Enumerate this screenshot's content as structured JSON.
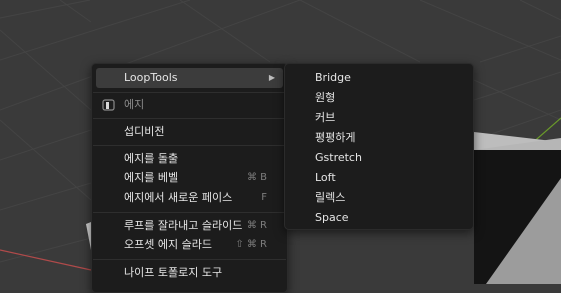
{
  "edge_menu": {
    "submenu_label": "LoopTools",
    "section_title": "에지",
    "items": {
      "subdivide": "섭디비전",
      "extrude_edges": "에지를 돌출",
      "bevel_edges": "에지를 베벨",
      "bevel_shortcut": "⌘ B",
      "new_face_from_edges": "에지에서 새로운 페이스",
      "new_face_shortcut": "F",
      "loop_cut_slide": "루프를 잘라내고 슬라이드",
      "loop_cut_shortcut": "⌘ R",
      "offset_edge_slide": "오프셋 에지 슬라드",
      "offset_shortcut": "⇧ ⌘ R",
      "knife_topology": "나이프 토폴로지 도구"
    }
  },
  "looptools_menu": {
    "items": [
      "Bridge",
      "원형",
      "커브",
      "평평하게",
      "Gstretch",
      "Loft",
      "릴렉스",
      "Space"
    ]
  },
  "colors": {
    "menu_bg": "#1c1c1c",
    "highlight_bg": "#3c3c3c",
    "viewport_bg": "#3a3a3a",
    "mesh_face": "#bdbdbd",
    "mesh_shadow": "#141414",
    "axis_x": "#b04a4a",
    "axis_y": "#6a9a2a"
  }
}
